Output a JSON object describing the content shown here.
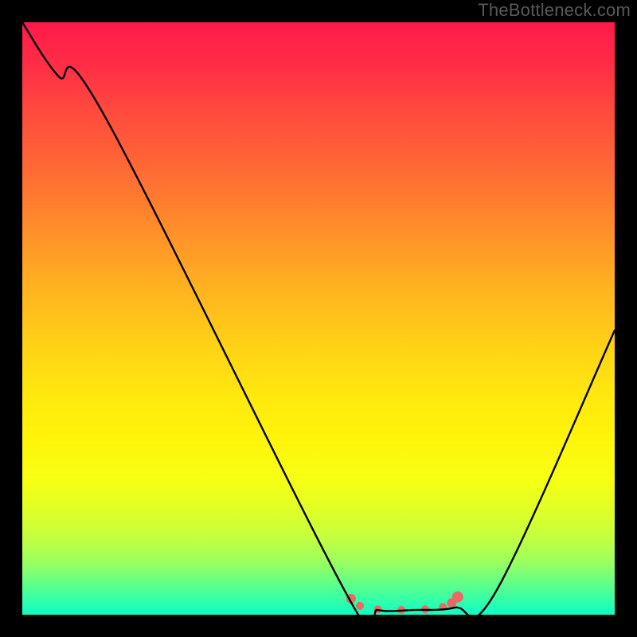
{
  "watermark": "TheBottleneck.com",
  "chart_data": {
    "type": "line",
    "title": "",
    "xlabel": "",
    "ylabel": "",
    "xlim": [
      0,
      100
    ],
    "ylim": [
      0,
      100
    ],
    "series": [
      {
        "name": "curve",
        "x": [
          0,
          6,
          14,
          55,
          60,
          66,
          73,
          80,
          100
        ],
        "y": [
          100,
          91,
          84,
          3,
          0.8,
          0.8,
          1.2,
          4,
          48
        ]
      }
    ],
    "markers": {
      "name": "highlight-band",
      "color": "#e86a63",
      "x": [
        55.5,
        57,
        60,
        64,
        68,
        71,
        72.5,
        73.5
      ],
      "y": [
        2.7,
        1.5,
        0.9,
        0.8,
        0.9,
        1.3,
        2.0,
        3.0
      ],
      "r": [
        6,
        5,
        5,
        5,
        5,
        5,
        6,
        7
      ]
    }
  }
}
